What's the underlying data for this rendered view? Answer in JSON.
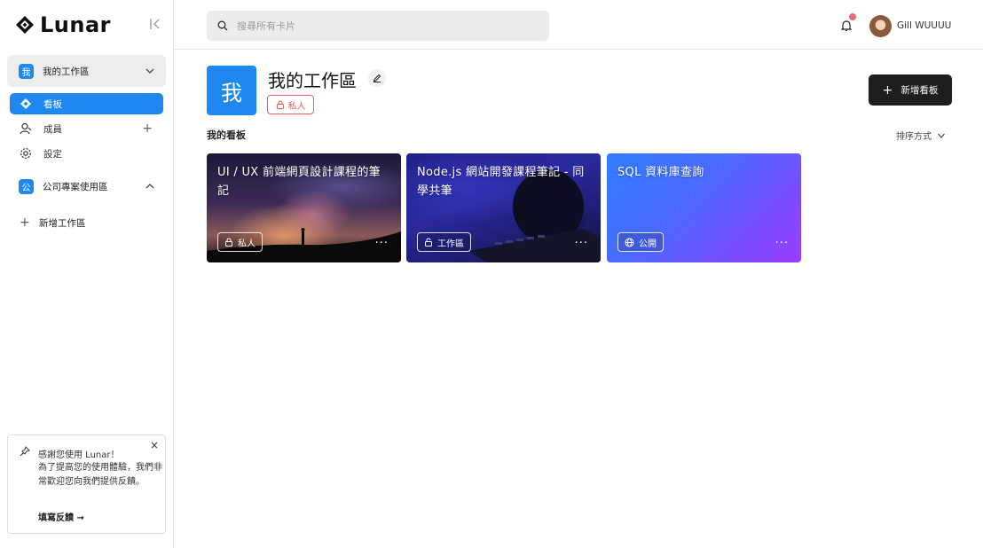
{
  "app": {
    "name": "Lunar"
  },
  "sidebar": {
    "workspace": {
      "badge": "我",
      "name": "我的工作區"
    },
    "items": [
      {
        "label": "看板",
        "icon": "board-icon"
      },
      {
        "label": "成員",
        "icon": "members-icon"
      },
      {
        "label": "設定",
        "icon": "gear-icon"
      }
    ],
    "workspace2": {
      "badge": "公",
      "name": "公司專案使用區"
    },
    "new_workspace": "新增工作區",
    "feedback": {
      "title": "感謝您使用 Lunar！",
      "body": "為了提高您的使用體驗，我們非常歡迎您向我們提供反饋。",
      "link": "填寫反饋 →",
      "close": "×"
    }
  },
  "topbar": {
    "search_placeholder": "搜尋所有卡片",
    "user": "Gill WUUUU"
  },
  "main": {
    "workspace_badge": "我",
    "title": "我的工作區",
    "privacy": "私人",
    "add_board": "新增看板",
    "section_title": "我的看板",
    "sort_label": "排序方式",
    "boards": [
      {
        "title": "UI / UX 前端網頁設計課程的筆記",
        "tag": "私人",
        "more": "···"
      },
      {
        "title": "Node.js 網站開發課程筆記 - 同學共筆",
        "tag": "工作區",
        "more": "···"
      },
      {
        "title": "SQL 資料庫查詢",
        "tag": "公開",
        "more": "···"
      }
    ]
  },
  "colors": {
    "accent": "#1e88f0",
    "danger": "#e85a5a",
    "dark_button": "#1e1e1e"
  }
}
